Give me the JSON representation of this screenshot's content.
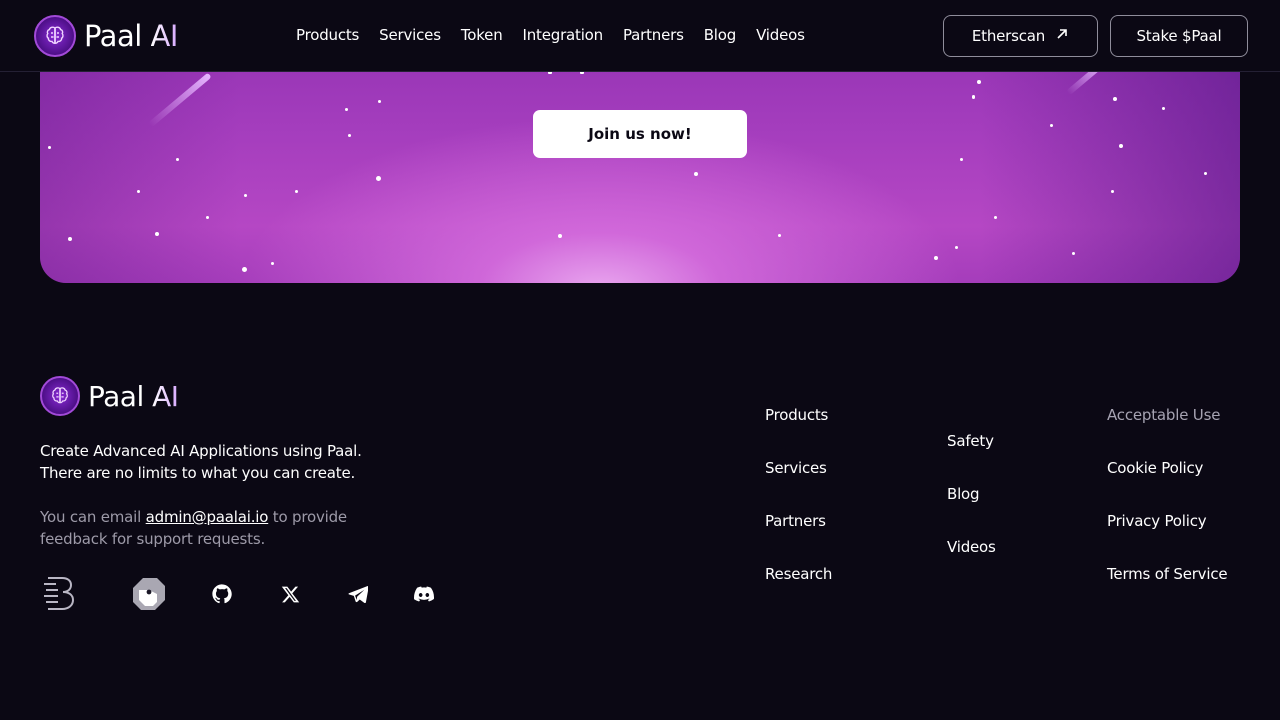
{
  "header": {
    "brand": {
      "name": "Paal",
      "suffix": "AI"
    },
    "nav": [
      "Products",
      "Services",
      "Token",
      "Integration",
      "Partners",
      "Blog",
      "Videos"
    ],
    "etherscan_label": "Etherscan",
    "stake_label": "Stake $Paal"
  },
  "hero": {
    "cta_label": "Join us now!"
  },
  "footer": {
    "brand": {
      "name": "Paal",
      "suffix": "AI"
    },
    "tagline_line1": "Create Advanced AI Applications using Paal.",
    "tagline_line2": "There are no limits to what you can create.",
    "contact_prefix": "You can email ",
    "contact_email": "admin@paalai.io",
    "contact_suffix": " to provide feedback for support requests.",
    "socials": [
      "b-logo-icon",
      "gecko-logo-icon",
      "github-icon",
      "x-icon",
      "telegram-icon",
      "discord-icon"
    ],
    "columns": [
      [
        "Products",
        "Services",
        "Partners",
        "Research"
      ],
      [
        "Safety",
        "Blog",
        "Videos"
      ],
      [
        "Acceptable Use",
        "Cookie Policy",
        "Privacy Policy",
        "Terms of Service"
      ]
    ]
  },
  "colors": {
    "background": "#0b0814",
    "accent": "#a43dbd",
    "muted_text": "#9d9aa8"
  }
}
